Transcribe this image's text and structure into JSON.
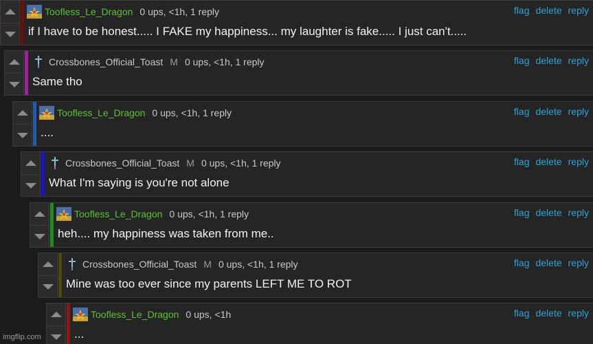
{
  "colors": {
    "username_green": "#5bc236",
    "link_blue": "#2fa3d6",
    "bar_dark_red": "#6b0e10",
    "bar_magenta": "#a0219e",
    "bar_blue": "#1a5fb4",
    "bar_deep_blue": "#1b12c9",
    "bar_green": "#1c8a1c",
    "bar_olive": "#4c4a12",
    "bar_red": "#8e1616"
  },
  "actions": {
    "flag": "flag",
    "delete": "delete",
    "reply": "reply"
  },
  "comments": [
    {
      "username": "Toofless_Le_Dragon",
      "badge": "",
      "meta": "0 ups, <1h, 1 reply",
      "text": "if I have to be honest..... I FAKE my happiness... my laughter is fake..... I just can't.....",
      "avatar": "dragon-avatar-icon"
    },
    {
      "username": "Crossbones_Official_Toast",
      "badge": "M",
      "meta": "0 ups, <1h, 1 reply",
      "text": "Same tho",
      "avatar": "dagger-icon"
    },
    {
      "username": "Toofless_Le_Dragon",
      "badge": "",
      "meta": "0 ups, <1h, 1 reply",
      "text": "....",
      "avatar": "dragon-avatar-icon"
    },
    {
      "username": "Crossbones_Official_Toast",
      "badge": "M",
      "meta": "0 ups, <1h, 1 reply",
      "text": "What I'm saying is you're not alone",
      "avatar": "dagger-icon"
    },
    {
      "username": "Toofless_Le_Dragon",
      "badge": "",
      "meta": "0 ups, <1h, 1 reply",
      "text": "heh.... my happiness was taken from me..",
      "avatar": "dragon-avatar-icon"
    },
    {
      "username": "Crossbones_Official_Toast",
      "badge": "M",
      "meta": "0 ups, <1h, 1 reply",
      "text": "Mine was too ever since my parents LEFT ME TO ROT",
      "avatar": "dagger-icon"
    },
    {
      "username": "Toofless_Le_Dragon",
      "badge": "",
      "meta": "0 ups, <1h",
      "text": "...",
      "avatar": "dragon-avatar-icon"
    }
  ],
  "watermark": "imgflip.com"
}
